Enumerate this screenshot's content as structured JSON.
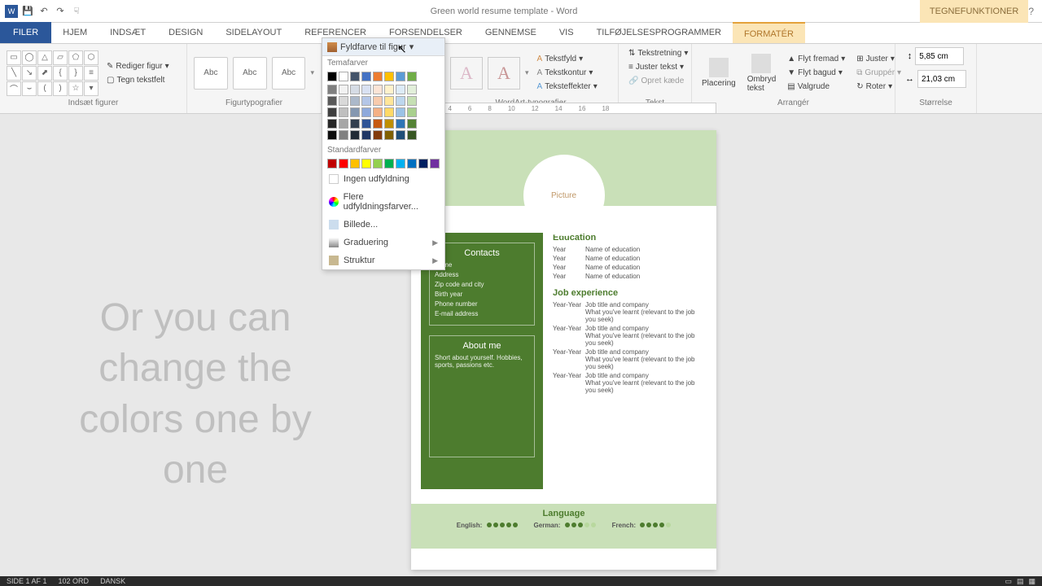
{
  "titlebar": {
    "title": "Green world resume template - Word",
    "contextual": "TEGNEFUNKTIONER"
  },
  "tabs": {
    "filer": "FILER",
    "hjem": "HJEM",
    "indset": "INDSÆT",
    "design": "DESIGN",
    "sidelayout": "SIDELAYOUT",
    "referencer": "REFERENCER",
    "forsendelser": "FORSENDELSER",
    "gennemse": "GENNEMSE",
    "vis": "VIS",
    "tilfoj": "TILFØJELSESPROGRAMMER",
    "formater": "FORMATÉR"
  },
  "ribbon": {
    "insert_shapes": "Indsæt figurer",
    "rediger": "Rediger figur",
    "tegn": "Tegn tekstfelt",
    "shape_styles": "Figurtypografier",
    "fyld": "Fyldfarve til figur",
    "abc": "Abc",
    "wordart": "WordArt-typografier",
    "tekstfyld": "Tekstfyld",
    "tekstkontur": "Tekstkontur",
    "teksteffekter": "Teksteffekter",
    "tekst": "Tekst",
    "tekstretning": "Tekstretning",
    "justertekst": "Juster tekst",
    "opret": "Opret kæde",
    "placering": "Placering",
    "ombryd": "Ombryd tekst",
    "flytfremad": "Flyt fremad",
    "flytbagud": "Flyt bagud",
    "valgrude": "Valgrude",
    "juster": "Juster",
    "grupper": "Gruppér",
    "roter": "Roter",
    "arranger": "Arrangér",
    "storrelse": "Størrelse",
    "h": "5,85 cm",
    "w": "21,03 cm"
  },
  "dropdown": {
    "tema": "Temafarver",
    "standard": "Standardfarver",
    "ingen": "Ingen udfyldning",
    "flere": "Flere udfyldningsfarver...",
    "billede": "Billede...",
    "graduering": "Graduering",
    "struktur": "Struktur",
    "theme_row1": [
      "#000",
      "#fff",
      "#44546a",
      "#4472c4",
      "#ed7d31",
      "#ffc000",
      "#5b9bd5",
      "#70ad47"
    ],
    "shades": [
      [
        "#7f7f7f",
        "#f2f2f2",
        "#d6dce5",
        "#d9e1f2",
        "#fce4d6",
        "#fff2cc",
        "#ddebf7",
        "#e2efda"
      ],
      [
        "#595959",
        "#d9d9d9",
        "#acb9ca",
        "#b4c6e7",
        "#f8cbad",
        "#ffe699",
        "#bdd7ee",
        "#c6e0b4"
      ],
      [
        "#3f3f3f",
        "#bfbfbf",
        "#8497b0",
        "#8ea9db",
        "#f4b084",
        "#ffd966",
        "#9bc2e6",
        "#a9d08e"
      ],
      [
        "#262626",
        "#a6a6a6",
        "#333f4f",
        "#305496",
        "#c65911",
        "#bf8f00",
        "#2f75b5",
        "#548235"
      ],
      [
        "#0d0d0d",
        "#808080",
        "#222b35",
        "#203764",
        "#833c0c",
        "#806000",
        "#1f4e78",
        "#375623"
      ]
    ],
    "standard_colors": [
      "#c00000",
      "#ff0000",
      "#ffc000",
      "#ffff00",
      "#92d050",
      "#00b050",
      "#00b0f0",
      "#0070c0",
      "#002060",
      "#7030a0"
    ]
  },
  "overlay": "Or you can change the colors one by one",
  "doc": {
    "picture": "Picture",
    "contacts_title": "Contacts",
    "contacts": [
      "Name",
      "Address",
      "Zip code and city",
      "Birth year",
      "Phone number",
      "E-mail address"
    ],
    "about_title": "About me",
    "about": "Short about yourself. Hobbies, sports, passions etc.",
    "edu_title": "Education",
    "edu": [
      {
        "y": "Year",
        "n": "Name of education"
      },
      {
        "y": "Year",
        "n": "Name of education"
      },
      {
        "y": "Year",
        "n": "Name of education"
      },
      {
        "y": "Year",
        "n": "Name of education"
      }
    ],
    "job_title": "Job experience",
    "jobs": [
      {
        "y": "Year-Year",
        "t": "Job title and company",
        "d": "What you've learnt (relevant to the job you seek)"
      },
      {
        "y": "Year-Year",
        "t": "Job title and company",
        "d": "What you've learnt (relevant to the job you seek)"
      },
      {
        "y": "Year-Year",
        "t": "Job title and company",
        "d": "What you've learnt (relevant to the job you seek)"
      },
      {
        "y": "Year-Year",
        "t": "Job title and company",
        "d": "What you've learnt (relevant to the job you seek)"
      }
    ],
    "lang_title": "Language",
    "langs": [
      {
        "n": "English:",
        "r": 5
      },
      {
        "n": "German:",
        "r": 3
      },
      {
        "n": "French:",
        "r": 4
      }
    ]
  },
  "status": {
    "page": "SIDE 1 AF 1",
    "words": "102 ORD",
    "lang": "DANSK"
  }
}
